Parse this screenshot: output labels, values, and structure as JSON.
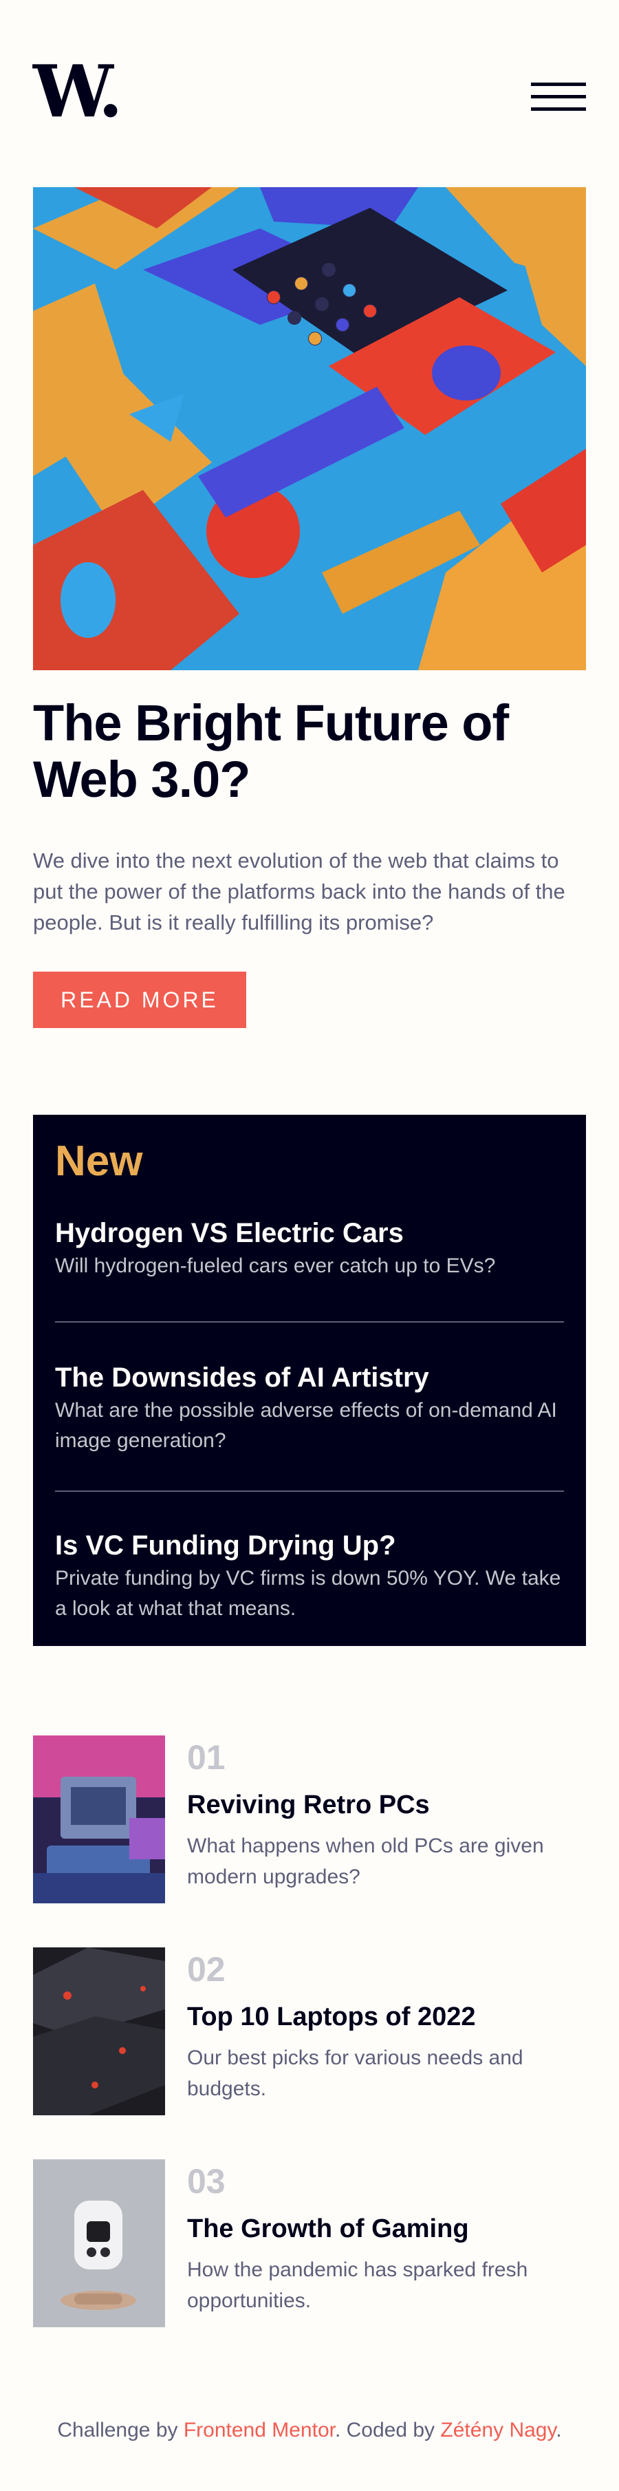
{
  "header": {
    "logo_text": "W.",
    "menu_icon": "hamburger-menu-icon"
  },
  "hero": {
    "title": "The Bright Future of Web 3.0?",
    "description": "We dive into the next evolution of the web that claims to put the power of the platforms back into the hands of the people. But is it really fulfilling its promise?",
    "button_label": "READ MORE"
  },
  "new_section": {
    "heading": "New",
    "items": [
      {
        "title": "Hydrogen VS Electric Cars",
        "description": "Will hydrogen-fueled cars ever catch up to EVs?"
      },
      {
        "title": "The Downsides of AI Artistry",
        "description": "What are the possible adverse effects of on-demand AI image generation?"
      },
      {
        "title": "Is VC Funding Drying Up?",
        "description": "Private funding by VC firms is down 50% YOY. We take a look at what that means."
      }
    ]
  },
  "articles": [
    {
      "number": "01",
      "title": "Reviving Retro PCs",
      "description": "What happens when old PCs are given modern upgrades?"
    },
    {
      "number": "02",
      "title": "Top 10 Laptops of 2022",
      "description": "Our best picks for various needs and budgets."
    },
    {
      "number": "03",
      "title": "The Growth of Gaming",
      "description": "How the pandemic has sparked fresh opportunities."
    }
  ],
  "footer": {
    "prefix": "Challenge by ",
    "link1": "Frontend Mentor",
    "middle": ". Coded by ",
    "link2": "Zétény Nagy",
    "suffix": "."
  },
  "colors": {
    "accent_red": "#f15d51",
    "accent_orange": "#e9ab53",
    "dark_navy": "#00001a",
    "grayish_blue": "#5d5f79",
    "off_white": "#fffdfa"
  }
}
